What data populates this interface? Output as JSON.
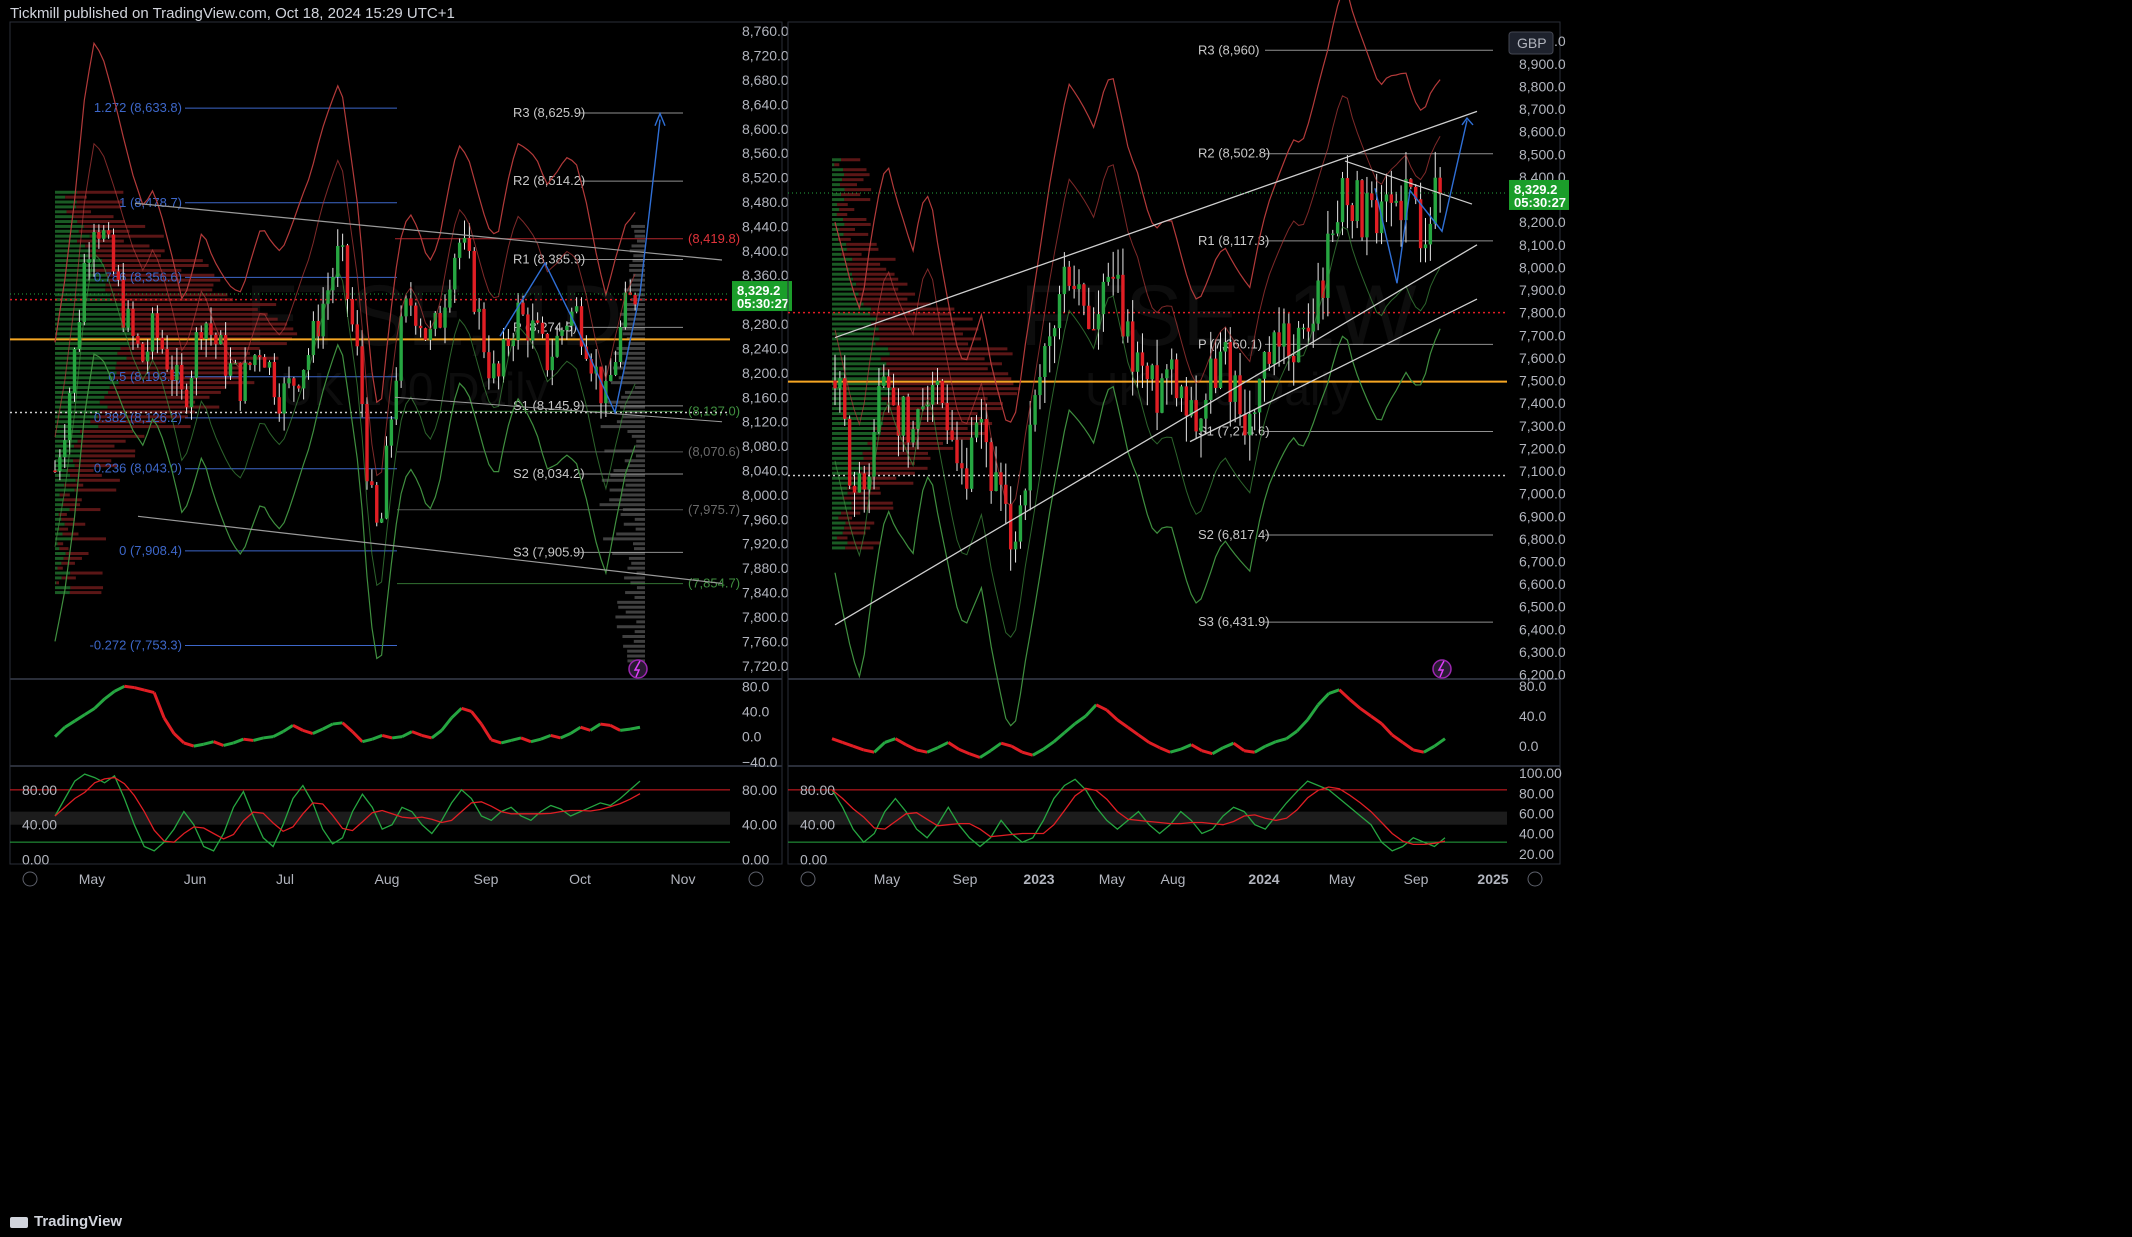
{
  "header": {
    "publisher": "Tickmill published on TradingView.com, Oct 18, 2024 15:29 UTC+1"
  },
  "footer": {
    "brand": "TradingView"
  },
  "colors": {
    "bull": "#26a641",
    "bear": "#e01e24",
    "fib": "#3d67c9",
    "pivot": "#cfcfcf",
    "poc": "#f5a623",
    "bb_upper": "#b33a3a",
    "bb_lower": "#3f8f3f",
    "arrow": "#2f6fd6",
    "price_box": "#1b9e2a",
    "hist_bull": "#1f6b2a",
    "hist_bear": "#7a1d1d"
  },
  "chart_data": [
    {
      "type": "candlestick",
      "panel": "left",
      "timeframe": "Daily",
      "watermark": "FTSE, 1D",
      "watermark_sub": "UK 100 Daily",
      "x_ticks": [
        "May",
        "Jun",
        "Jul",
        "Aug",
        "Sep",
        "Oct",
        "Nov"
      ],
      "y_ticks": [
        "8,760.0",
        "8,720.0",
        "8,680.0",
        "8,640.0",
        "8,600.0",
        "8,560.0",
        "8,520.0",
        "8,480.0",
        "8,440.0",
        "8,400.0",
        "8,360.0",
        "8,320.0",
        "8,280.0",
        "8,240.0",
        "8,200.0",
        "8,160.0",
        "8,120.0",
        "8,080.0",
        "8,040.0",
        "8,000.0",
        "7,960.0",
        "7,920.0",
        "7,880.0",
        "7,840.0",
        "7,800.0",
        "7,760.0",
        "7,720.0"
      ],
      "ylim": [
        7700,
        8775
      ],
      "last_price": "8,329.2",
      "countdown": "05:30:27",
      "pivots": [
        {
          "label": "R3 (8,625.9)",
          "value": 8625.9
        },
        {
          "label": "R2 (8,514.2)",
          "value": 8514.2
        },
        {
          "label": "R1 (8,385.9)",
          "value": 8385.9
        },
        {
          "label": "P (8,274.5)",
          "value": 8274.5
        },
        {
          "label": "S1 (8,145.9)",
          "value": 8145.9
        },
        {
          "label": "S2 (8,034.2)",
          "value": 8034.2
        },
        {
          "label": "S3 (7,905.9)",
          "value": 7905.9
        }
      ],
      "fib_levels": [
        {
          "label": "1.272 (8,633.8)",
          "value": 8633.8
        },
        {
          "label": "1 (8,478.7)",
          "value": 8478.7
        },
        {
          "label": "0.786 (8,356.6)",
          "value": 8356.6
        },
        {
          "label": "0.5 (8,193.6)",
          "value": 8193.6
        },
        {
          "label": "0.382 (8,126.2)",
          "value": 8126.2
        },
        {
          "label": "0.236 (8,043.0)",
          "value": 8043.0
        },
        {
          "label": "0 (7,908.4)",
          "value": 7908.4
        },
        {
          "label": "-0.272 (7,753.3)",
          "value": 7753.3
        }
      ],
      "side_levels": [
        {
          "label": "(8,419.8)",
          "value": 8419.8
        },
        {
          "label": "(8,137.0)",
          "value": 8137.0
        },
        {
          "label": "(8,070.6)",
          "value": 8070.6
        },
        {
          "label": "(7,975.7)",
          "value": 7975.7
        },
        {
          "label": "(7,854.7)",
          "value": 7854.7
        }
      ],
      "poc": 8255,
      "close_path": [
        8040,
        8120,
        8230,
        8380,
        8460,
        8420,
        8360,
        8300,
        8250,
        8220,
        8270,
        8240,
        8200,
        8150,
        8220,
        8300,
        8260,
        8230,
        8200,
        8180,
        8220,
        8250,
        8200,
        8160,
        8180,
        8210,
        8240,
        8300,
        8350,
        8400,
        8300,
        8200,
        8000,
        7920,
        8100,
        8250,
        8320,
        8300,
        8250,
        8280,
        8360,
        8420,
        8380,
        8300,
        8220,
        8180,
        8250,
        8300,
        8280,
        8260,
        8220,
        8250,
        8290,
        8300,
        8260,
        8200,
        8150,
        8230,
        8300,
        8330
      ],
      "osc1": {
        "ticks": [
          "80.0",
          "40.0",
          "0.0",
          "−40.0"
        ],
        "ylim": [
          -45,
          90
        ],
        "values": [
          0,
          15,
          25,
          35,
          45,
          60,
          72,
          80,
          78,
          74,
          70,
          30,
          5,
          -10,
          -15,
          -12,
          -8,
          -14,
          -10,
          -4,
          -6,
          -2,
          0,
          8,
          18,
          10,
          5,
          12,
          20,
          22,
          8,
          -8,
          -4,
          2,
          -2,
          0,
          8,
          2,
          -2,
          10,
          30,
          45,
          40,
          20,
          -5,
          -10,
          -6,
          -2,
          -8,
          -4,
          2,
          -2,
          5,
          15,
          10,
          20,
          18,
          10,
          12,
          15
        ]
      },
      "osc2": {
        "ticks": [
          "80.00",
          "40.00",
          "0.00"
        ],
        "right_ticks": [
          "80.00",
          "40.00",
          "0.00"
        ],
        "ylim": [
          -5,
          105
        ],
        "values": [
          50,
          70,
          90,
          98,
          94,
          88,
          96,
          70,
          40,
          15,
          10,
          20,
          35,
          55,
          40,
          15,
          10,
          30,
          60,
          78,
          50,
          25,
          15,
          40,
          70,
          85,
          65,
          35,
          18,
          25,
          55,
          75,
          60,
          35,
          40,
          60,
          55,
          40,
          30,
          45,
          65,
          80,
          70,
          50,
          45,
          55,
          60,
          50,
          45,
          55,
          62,
          58,
          50,
          55,
          60,
          65,
          62,
          70,
          80,
          90
        ]
      }
    },
    {
      "type": "candlestick",
      "panel": "right",
      "timeframe": "Weekly",
      "watermark": "FTSE, 1W",
      "watermark_sub": "UK 100 Daily",
      "currency": "GBP",
      "x_ticks": [
        "May",
        "Sep",
        "2023",
        "May",
        "Aug",
        "2024",
        "May",
        "Sep",
        "2025"
      ],
      "y_ticks": [
        "9,000.0",
        "8,900.0",
        "8,800.0",
        "8,700.0",
        "8,600.0",
        "8,500.0",
        "8,400.0",
        "8,300.0",
        "8,200.0",
        "8,100.0",
        "8,000.0",
        "7,900.0",
        "7,800.0",
        "7,700.0",
        "7,600.0",
        "7,500.0",
        "7,400.0",
        "7,300.0",
        "7,200.0",
        "7,100.0",
        "7,000.0",
        "6,900.0",
        "6,800.0",
        "6,700.0",
        "6,600.0",
        "6,500.0",
        "6,400.0",
        "6,300.0",
        "6,200.0"
      ],
      "ylim": [
        6185,
        9085
      ],
      "last_price": "8,329.2",
      "countdown": "05:30:27",
      "pivots": [
        {
          "label": "R3 (8,960)",
          "value": 8960
        },
        {
          "label": "R2 (8,502.8)",
          "value": 8502.8
        },
        {
          "label": "R1 (8,117.3)",
          "value": 8117.3
        },
        {
          "label": "P (7,660.1)",
          "value": 7660.1
        },
        {
          "label": "S1 (7,274.6)",
          "value": 7274.6
        },
        {
          "label": "S2 (6,817.4)",
          "value": 6817.4
        },
        {
          "label": "S3 (6,431.9)",
          "value": 6431.9
        }
      ],
      "poc": 7495,
      "close_path": [
        7500,
        7300,
        7100,
        6950,
        7200,
        7400,
        7550,
        7400,
        7300,
        7200,
        7450,
        7550,
        7350,
        7200,
        7050,
        7000,
        7150,
        7300,
        7100,
        6950,
        6800,
        6850,
        7100,
        7300,
        7500,
        7700,
        7850,
        8000,
        7900,
        7800,
        7700,
        7850,
        7950,
        7800,
        7650,
        7600,
        7500,
        7450,
        7550,
        7600,
        7500,
        7400,
        7350,
        7450,
        7550,
        7600,
        7500,
        7400,
        7300,
        7450,
        7550,
        7600,
        7650,
        7700,
        7650,
        7750,
        7900,
        8050,
        8250,
        8400,
        8300,
        8250,
        8200,
        8150,
        8250,
        8300,
        8350,
        8250,
        8200,
        8300,
        8330
      ],
      "osc1": {
        "ticks": [
          "80.0",
          "40.0",
          "0.0"
        ],
        "ylim": [
          -25,
          88
        ],
        "values": [
          10,
          5,
          0,
          -5,
          -8,
          5,
          10,
          2,
          -5,
          -8,
          -2,
          5,
          -4,
          -10,
          -15,
          -6,
          4,
          0,
          -8,
          -12,
          -4,
          6,
          18,
          30,
          40,
          55,
          48,
          35,
          25,
          15,
          5,
          -2,
          -8,
          -4,
          2,
          -6,
          -10,
          -2,
          4,
          -6,
          -8,
          0,
          6,
          10,
          20,
          35,
          55,
          70,
          75,
          62,
          50,
          40,
          30,
          15,
          5,
          -5,
          -8,
          0,
          10
        ]
      },
      "osc2": {
        "ticks": [
          "80.00",
          "40.00",
          "0.00"
        ],
        "right_ticks": [
          "100.00",
          "80.00",
          "60.00",
          "40.00",
          "20.00"
        ],
        "ylim": [
          -5,
          105
        ],
        "values": [
          80,
          60,
          35,
          20,
          30,
          55,
          70,
          55,
          35,
          25,
          40,
          60,
          40,
          25,
          15,
          25,
          45,
          30,
          20,
          25,
          45,
          70,
          85,
          92,
          80,
          60,
          45,
          35,
          45,
          55,
          40,
          30,
          40,
          55,
          45,
          30,
          35,
          50,
          60,
          55,
          40,
          35,
          50,
          65,
          78,
          90,
          85,
          80,
          70,
          60,
          50,
          40,
          20,
          10,
          15,
          25,
          20,
          15,
          25
        ]
      }
    }
  ]
}
